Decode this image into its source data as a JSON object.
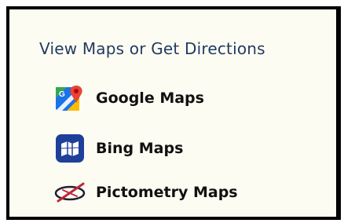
{
  "panel": {
    "heading": "View Maps or Get Directions",
    "items": [
      {
        "label": "Google Maps",
        "icon": "google-maps-icon"
      },
      {
        "label": "Bing Maps",
        "icon": "bing-maps-icon"
      },
      {
        "label": "Pictometry Maps",
        "icon": "pictometry-icon"
      }
    ]
  },
  "colors": {
    "background": "#fdfcf3",
    "border": "#000000",
    "heading": "#1f3a5f",
    "bing_blue": "#1e3f9a",
    "pictometry_red": "#c0283a"
  }
}
